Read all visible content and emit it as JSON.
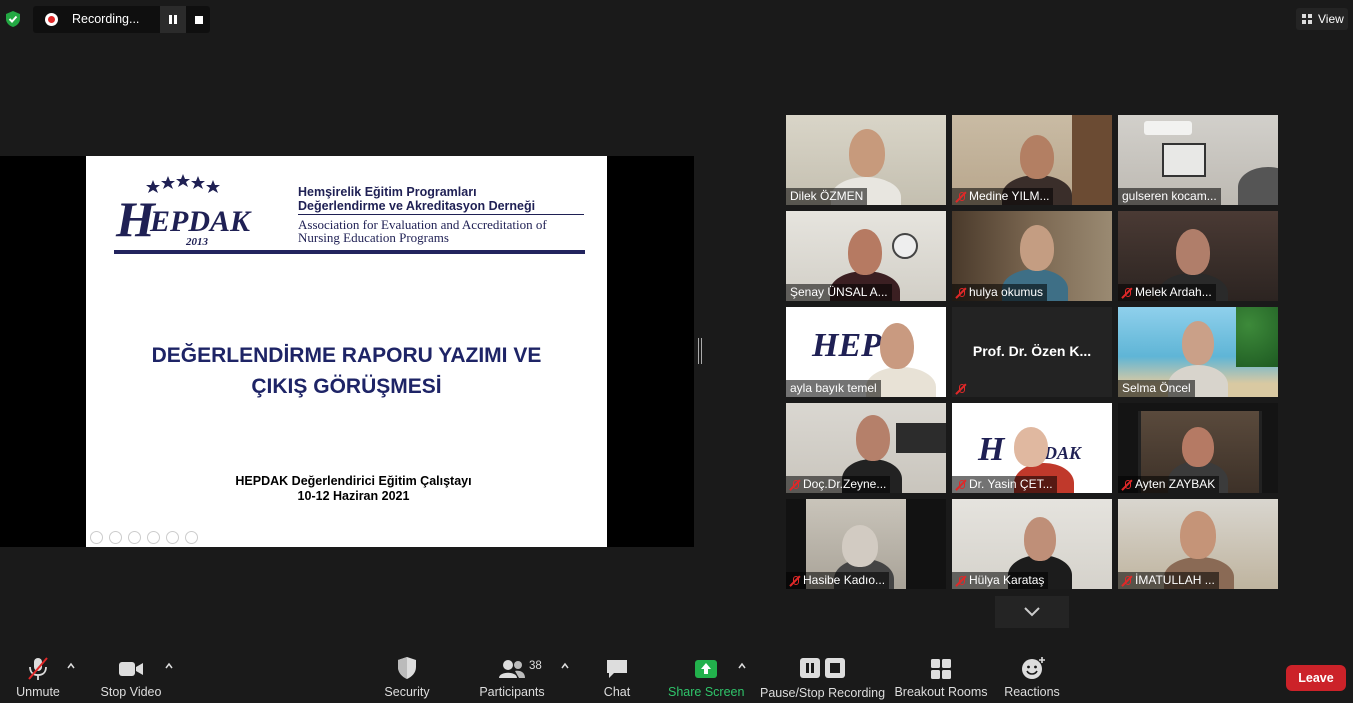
{
  "topbar": {
    "recording_label": "Recording...",
    "view_label": "View"
  },
  "slide": {
    "logo_text": "HEPDAK",
    "logo_year": "2013",
    "org_tr_line1": "Hemşirelik Eğitim Programları",
    "org_tr_line2": "Değerlendirme ve Akreditasyon Derneği",
    "org_en_line1": "Association for Evaluation and Accreditation of",
    "org_en_line2": "Nursing Education Programs",
    "title_line1": "DEĞERLENDİRME RAPORU YAZIMI VE",
    "title_line2": "ÇIKIŞ GÖRÜŞMESİ",
    "footer_line1": "HEPDAK Değerlendirici Eğitim Çalıştayı",
    "footer_line2": "10-12 Haziran 2021"
  },
  "participants": [
    {
      "name": "Dilek ÖZMEN",
      "muted": false
    },
    {
      "name": "Medine YILM...",
      "muted": true
    },
    {
      "name": "gulseren kocam...",
      "muted": false
    },
    {
      "name": "Şenay ÜNSAL A...",
      "muted": false
    },
    {
      "name": "hulya okumus",
      "muted": true
    },
    {
      "name": "Melek Ardah...",
      "muted": true
    },
    {
      "name": "ayla bayık temel",
      "muted": false
    },
    {
      "name": "Prof. Dr. Özen K...",
      "muted": true
    },
    {
      "name": "Selma Öncel",
      "muted": false
    },
    {
      "name": "Doç.Dr.Zeyne...",
      "muted": true
    },
    {
      "name": "Dr. Yasin ÇET...",
      "muted": true
    },
    {
      "name": "Ayten ZAYBAK",
      "muted": true
    },
    {
      "name": "Hasibe Kadıo...",
      "muted": true
    },
    {
      "name": "Hülya Karataş",
      "muted": true
    },
    {
      "name": "İMATULLAH ...",
      "muted": true
    }
  ],
  "toolbar": {
    "unmute": "Unmute",
    "stop_video": "Stop Video",
    "security": "Security",
    "participants": "Participants",
    "participant_count": "38",
    "chat": "Chat",
    "share_screen": "Share Screen",
    "pause_stop_recording": "Pause/Stop Recording",
    "breakout_rooms": "Breakout Rooms",
    "reactions": "Reactions",
    "leave": "Leave"
  },
  "colors": {
    "background": "#1a1a1a",
    "leave": "#cc2229",
    "share_green": "#22b14c",
    "active_speaker": "#d8e040",
    "slide_navy": "#1e2466"
  }
}
